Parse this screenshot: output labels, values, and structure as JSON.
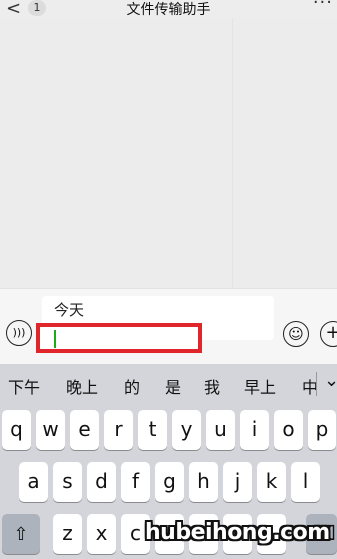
{
  "header": {
    "back_glyph": "<",
    "unread_badge": "1",
    "title": "文件传输助手",
    "more_glyph": "···"
  },
  "input_area": {
    "preview_text": "今天",
    "input_value": "",
    "highlight_color": "#e0262b"
  },
  "candidates": [
    "下午",
    "晚上",
    "的",
    "是",
    "我",
    "早上",
    "中"
  ],
  "keyboard": {
    "row1": [
      "q",
      "w",
      "e",
      "r",
      "t",
      "y",
      "u",
      "i",
      "o",
      "p"
    ],
    "row2": [
      "a",
      "s",
      "d",
      "f",
      "g",
      "h",
      "j",
      "k",
      "l"
    ],
    "row3": [
      "z",
      "x",
      "c"
    ]
  },
  "watermark": "hubeihong.com"
}
